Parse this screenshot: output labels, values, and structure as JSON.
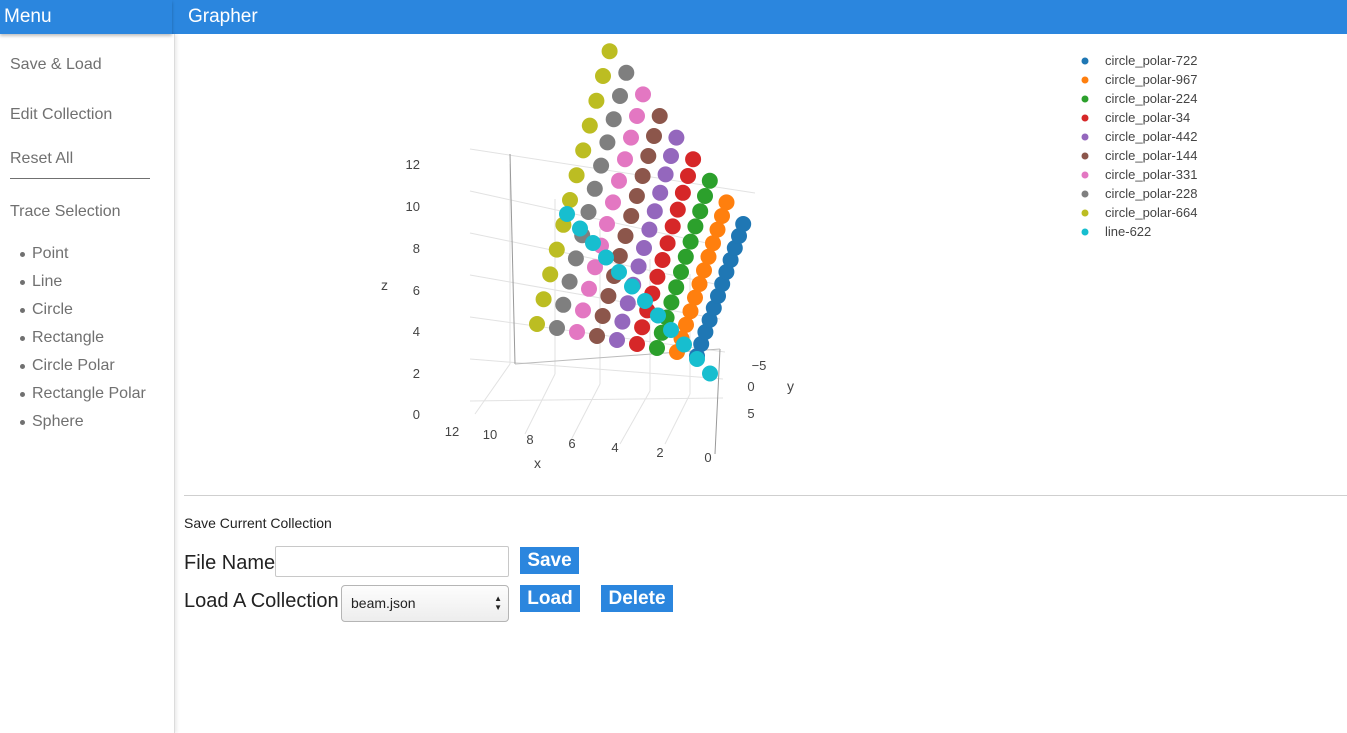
{
  "header": {
    "menu_title": "Menu",
    "app_title": "Grapher"
  },
  "sidebar": {
    "links": [
      "Save & Load",
      "Edit Collection",
      "Reset All",
      "Trace Selection"
    ],
    "trace_items": [
      "Point",
      "Line",
      "Circle",
      "Rectangle",
      "Circle Polar",
      "Rectangle Polar",
      "Sphere"
    ]
  },
  "form": {
    "save_title": "Save Current Collection",
    "file_name_label": "File Name",
    "file_name_value": "",
    "save_label": "Save",
    "load_label_text": "Load A Collection",
    "selected_collection": "beam.json",
    "load_label": "Load",
    "delete_label": "Delete"
  },
  "chart_data": {
    "type": "scatter",
    "x_label": "x",
    "y_label": "y",
    "z_label": "z",
    "x_ticks": [
      "12",
      "10",
      "8",
      "6",
      "4",
      "2",
      "0"
    ],
    "y_ticks": [
      "−5",
      "0",
      "5"
    ],
    "z_ticks": [
      "0",
      "2",
      "4",
      "6",
      "8",
      "10",
      "12"
    ],
    "series": [
      {
        "name": "circle_polar-722",
        "color": "#1f77b4",
        "offset": 0
      },
      {
        "name": "circle_polar-967",
        "color": "#ff7f0e",
        "offset": 1
      },
      {
        "name": "circle_polar-224",
        "color": "#2ca02c",
        "offset": 2
      },
      {
        "name": "circle_polar-34",
        "color": "#d62728",
        "offset": 3
      },
      {
        "name": "circle_polar-442",
        "color": "#9467bd",
        "offset": 4
      },
      {
        "name": "circle_polar-144",
        "color": "#8c564b",
        "offset": 5
      },
      {
        "name": "circle_polar-331",
        "color": "#e377c2",
        "offset": 6
      },
      {
        "name": "circle_polar-228",
        "color": "#7f7f7f",
        "offset": 7
      },
      {
        "name": "circle_polar-664",
        "color": "#bcbd22",
        "offset": 8
      },
      {
        "name": "line-622",
        "color": "#17becf",
        "offset": 9
      }
    ]
  }
}
